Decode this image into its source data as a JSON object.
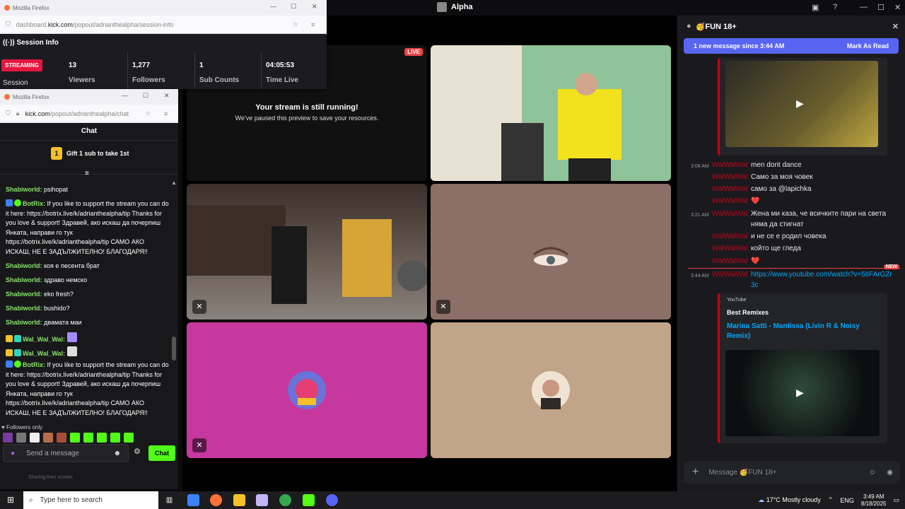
{
  "discord": {
    "window_title": "Alpha",
    "stage": {
      "live_badge": "LIVE",
      "paused_title": "Your stream is still running!",
      "paused_sub": "We've paused this preview to save your resources."
    },
    "channel": {
      "name": "🥳FUN 18+",
      "new_message_bar": "1 new message since 3:44 AM",
      "mark_as_read": "Mark As Read",
      "new_tag": "NEW",
      "messages": [
        {
          "time": "3:08 AM",
          "user": "WalWalWal",
          "text": "men dont dance"
        },
        {
          "time": "",
          "user": "WalWalWal",
          "text": "Само за моя човек"
        },
        {
          "time": "",
          "user": "WalWalWal",
          "text": "само за @lapichka"
        },
        {
          "time": "",
          "user": "WalWalWal",
          "text": "❤️"
        },
        {
          "time": "3:21 AM",
          "user": "WalWalWal",
          "text": "Жена ми каза, че всичките пари на света няма да стигнат"
        },
        {
          "time": "",
          "user": "WalWalWal",
          "text": "и не се е родил човека"
        },
        {
          "time": "",
          "user": "WalWalWal",
          "text": "който ще гледа"
        },
        {
          "time": "",
          "user": "WalWalWal",
          "text": "❤️"
        },
        {
          "time": "3:44 AM",
          "user": "WalWalWal",
          "text": "https://www.youtube.com/watch?v=5tiFArGZr3c"
        }
      ],
      "embed": {
        "provider": "YouTube",
        "author": "Best Remixes",
        "title": "Marina Satti - Mantissa (Livin R & Noisy Remix)"
      },
      "input_placeholder": "Message 🥳FUN 18+"
    }
  },
  "session_window": {
    "title": "Mozilla Firefox",
    "url_prefix": "dashboard.",
    "url_domain": "kick.com",
    "url_path": "/popout/adrianthealpha/session-info",
    "heading": "Session Info",
    "streaming_badge": "STREAMING",
    "session_label": "Session",
    "stats": [
      {
        "value": "13",
        "label": "Viewers"
      },
      {
        "value": "1,277",
        "label": "Followers"
      },
      {
        "value": "1",
        "label": "Sub Counts"
      },
      {
        "value": "04:05:53",
        "label": "Time Live"
      }
    ]
  },
  "chat_window": {
    "title": "Mozilla Firefox",
    "url_domain": "kick.com",
    "url_path": "/popout/adrianthealpha/chat",
    "heading": "Chat",
    "gift_text": "Gift 1 sub to take 1st",
    "gift_rank": "1",
    "lines": [
      {
        "name": "Shabiworld:",
        "text": "psihopat"
      },
      {
        "name": "BotRix:",
        "text": "If you like to support the stream you can do it here: https://botrix.live/k/adrianthealpha/tip Thanks for you love & support! Здравей, ако искаш да почерпиш Янката, направи го тук https://botrix.live/k/adrianthealpha/tip САМО АКО ИСКАШ, НЕ Е ЗАДЪЛЖИТЕЛНО! БЛАГОДАРЯ!!"
      },
      {
        "name": "Shabiworld:",
        "text": "коя е песента брат"
      },
      {
        "name": "Shabiworld:",
        "text": "здраво немско"
      },
      {
        "name": "Shabiworld:",
        "text": "eko fresh?"
      },
      {
        "name": "Shabiworld:",
        "text": "bushido?"
      },
      {
        "name": "Shabiworld:",
        "text": "двамата маи"
      },
      {
        "name": "Wal_Wal_Wal:",
        "text": ""
      },
      {
        "name": "Wal_Wal_Wal:",
        "text": ""
      },
      {
        "name": "BotRix:",
        "text": "If you like to support the stream you can do it here: https://botrix.live/k/adrianthealpha/tip Thanks for you love & support! Здравей, ако искаш да почерпиш Янката, направи го тук https://botrix.live/k/adrianthealpha/tip САМО АКО ИСКАШ, НЕ Е ЗАДЪЛЖИТЕЛНО! БЛАГОДАРЯ!!"
      }
    ],
    "followers_only": "Followers only",
    "input_placeholder": "Send a message",
    "send_label": "Chat",
    "footer_text": "Sharing their screen"
  },
  "taskbar": {
    "search_placeholder": "Type here to search",
    "weather": "17°C  Mostly cloudy",
    "lang": "ENG",
    "time": "3:49 AM",
    "date": "8/18/2025"
  },
  "colors": {
    "discord_bg": "#0d0d0f",
    "blurple": "#5865f2",
    "mention_red": "#c80018",
    "kick_green": "#53fc18",
    "streaming_red": "#e3173e"
  }
}
